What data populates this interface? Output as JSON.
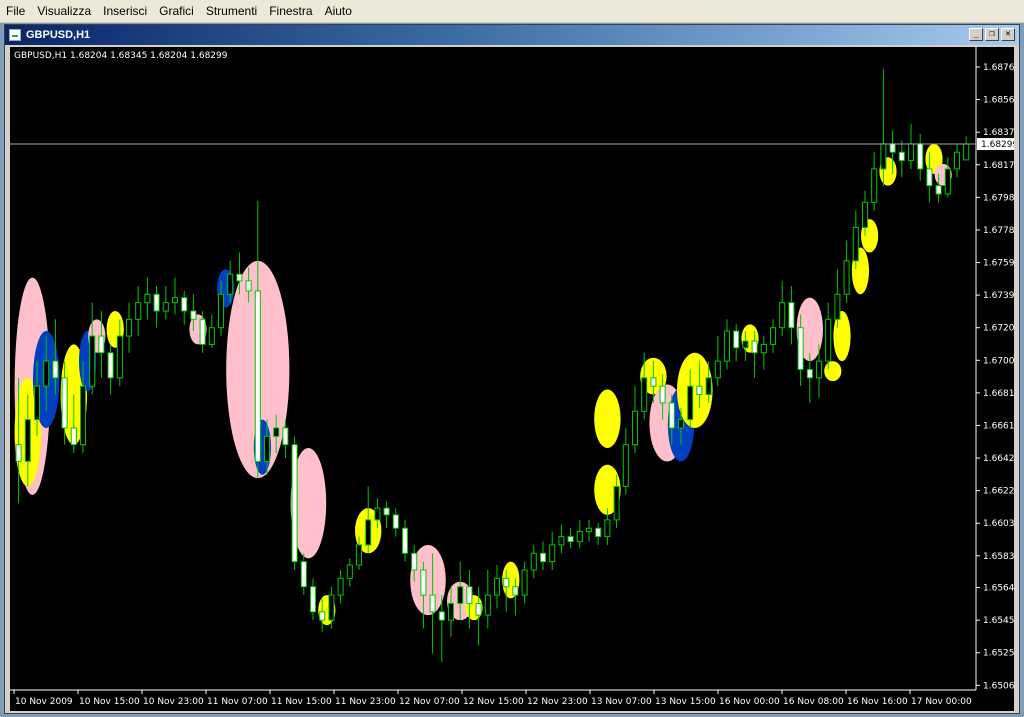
{
  "menubar": {
    "items": [
      "File",
      "Visualizza",
      "Inserisci",
      "Grafici",
      "Strumenti",
      "Finestra",
      "Aiuto"
    ]
  },
  "window": {
    "title": "GBPUSD,H1",
    "buttons": [
      "minimize",
      "restore",
      "close"
    ]
  },
  "chart": {
    "info": "GBPUSD,H1  1.68204 1.68345 1.68204 1.68299",
    "bid_label": "1.68299",
    "colors": {
      "background": "#000000",
      "candle_outline": "#00c800",
      "bull_body": "#000000",
      "bear_body": "#ffffff",
      "axis_text": "#ffffff",
      "bid_line": "#a0a8b0",
      "ellipse_pink": "#ffc0cb",
      "ellipse_yellow": "#ffff00",
      "ellipse_blue": "#0040c0"
    }
  },
  "chart_data": {
    "type": "candlestick",
    "symbol": "GBPUSD",
    "timeframe": "H1",
    "ylim": [
      1.6505,
      1.6876
    ],
    "y_ticks": [
      "1.68760",
      "1.68565",
      "1.68370",
      "1.68175",
      "1.67980",
      "1.67785",
      "1.67590",
      "1.67395",
      "1.67200",
      "1.67005",
      "1.66810",
      "1.66615",
      "1.66420",
      "1.66225",
      "1.66030",
      "1.65835",
      "1.65645",
      "1.65450",
      "1.65255",
      "1.65060"
    ],
    "x_ticks": [
      "10 Nov 2009",
      "10 Nov 15:00",
      "10 Nov 23:00",
      "11 Nov 07:00",
      "11 Nov 15:00",
      "11 Nov 23:00",
      "12 Nov 07:00",
      "12 Nov 15:00",
      "12 Nov 23:00",
      "13 Nov 07:00",
      "13 Nov 15:00",
      "16 Nov 00:00",
      "16 Nov 08:00",
      "16 Nov 16:00",
      "17 Nov 00:00"
    ],
    "bid": 1.68299,
    "candles": [
      {
        "o": 1.665,
        "c": 1.664,
        "h": 1.669,
        "l": 1.6615
      },
      {
        "o": 1.664,
        "c": 1.6665,
        "h": 1.668,
        "l": 1.6625
      },
      {
        "o": 1.6665,
        "c": 1.6685,
        "h": 1.67,
        "l": 1.6655
      },
      {
        "o": 1.6685,
        "c": 1.67,
        "h": 1.6715,
        "l": 1.667
      },
      {
        "o": 1.67,
        "c": 1.669,
        "h": 1.6725,
        "l": 1.668
      },
      {
        "o": 1.669,
        "c": 1.666,
        "h": 1.67,
        "l": 1.665
      },
      {
        "o": 1.666,
        "c": 1.665,
        "h": 1.668,
        "l": 1.6645
      },
      {
        "o": 1.665,
        "c": 1.6685,
        "h": 1.67,
        "l": 1.6645
      },
      {
        "o": 1.6685,
        "c": 1.6715,
        "h": 1.6735,
        "l": 1.668
      },
      {
        "o": 1.6715,
        "c": 1.6705,
        "h": 1.673,
        "l": 1.669
      },
      {
        "o": 1.6705,
        "c": 1.669,
        "h": 1.671,
        "l": 1.668
      },
      {
        "o": 1.669,
        "c": 1.6715,
        "h": 1.6725,
        "l": 1.6685
      },
      {
        "o": 1.6715,
        "c": 1.6725,
        "h": 1.6735,
        "l": 1.6705
      },
      {
        "o": 1.6725,
        "c": 1.6735,
        "h": 1.6745,
        "l": 1.6715
      },
      {
        "o": 1.6735,
        "c": 1.674,
        "h": 1.675,
        "l": 1.6725
      },
      {
        "o": 1.674,
        "c": 1.673,
        "h": 1.6745,
        "l": 1.672
      },
      {
        "o": 1.673,
        "c": 1.6735,
        "h": 1.6745,
        "l": 1.6725
      },
      {
        "o": 1.6735,
        "c": 1.6738,
        "h": 1.675,
        "l": 1.6728
      },
      {
        "o": 1.6738,
        "c": 1.673,
        "h": 1.6742,
        "l": 1.6722
      },
      {
        "o": 1.673,
        "c": 1.6725,
        "h": 1.674,
        "l": 1.6718
      },
      {
        "o": 1.6725,
        "c": 1.671,
        "h": 1.673,
        "l": 1.6705
      },
      {
        "o": 1.671,
        "c": 1.672,
        "h": 1.6728,
        "l": 1.6708
      },
      {
        "o": 1.672,
        "c": 1.674,
        "h": 1.6748,
        "l": 1.6715
      },
      {
        "o": 1.674,
        "c": 1.6752,
        "h": 1.676,
        "l": 1.6735
      },
      {
        "o": 1.6752,
        "c": 1.6748,
        "h": 1.6765,
        "l": 1.674
      },
      {
        "o": 1.6748,
        "c": 1.6742,
        "h": 1.6756,
        "l": 1.6735
      },
      {
        "o": 1.6742,
        "c": 1.664,
        "h": 1.6796,
        "l": 1.663
      },
      {
        "o": 1.664,
        "c": 1.6655,
        "h": 1.6665,
        "l": 1.6632
      },
      {
        "o": 1.6655,
        "c": 1.666,
        "h": 1.6668,
        "l": 1.6645
      },
      {
        "o": 1.666,
        "c": 1.665,
        "h": 1.6665,
        "l": 1.6642
      },
      {
        "o": 1.665,
        "c": 1.658,
        "h": 1.6655,
        "l": 1.6575
      },
      {
        "o": 1.658,
        "c": 1.6565,
        "h": 1.6585,
        "l": 1.656
      },
      {
        "o": 1.6565,
        "c": 1.655,
        "h": 1.657,
        "l": 1.6545
      },
      {
        "o": 1.655,
        "c": 1.6545,
        "h": 1.6558,
        "l": 1.6538
      },
      {
        "o": 1.6545,
        "c": 1.656,
        "h": 1.6565,
        "l": 1.654
      },
      {
        "o": 1.656,
        "c": 1.657,
        "h": 1.6575,
        "l": 1.6555
      },
      {
        "o": 1.657,
        "c": 1.6578,
        "h": 1.6582,
        "l": 1.6565
      },
      {
        "o": 1.6578,
        "c": 1.659,
        "h": 1.6595,
        "l": 1.6575
      },
      {
        "o": 1.659,
        "c": 1.6605,
        "h": 1.6625,
        "l": 1.6585
      },
      {
        "o": 1.6605,
        "c": 1.6612,
        "h": 1.6618,
        "l": 1.66
      },
      {
        "o": 1.6612,
        "c": 1.6608,
        "h": 1.6616,
        "l": 1.66
      },
      {
        "o": 1.6608,
        "c": 1.66,
        "h": 1.6612,
        "l": 1.6595
      },
      {
        "o": 1.66,
        "c": 1.6585,
        "h": 1.6605,
        "l": 1.658
      },
      {
        "o": 1.6585,
        "c": 1.6575,
        "h": 1.659,
        "l": 1.6568
      },
      {
        "o": 1.6575,
        "c": 1.656,
        "h": 1.658,
        "l": 1.654
      },
      {
        "o": 1.656,
        "c": 1.655,
        "h": 1.6585,
        "l": 1.6525
      },
      {
        "o": 1.655,
        "c": 1.6545,
        "h": 1.656,
        "l": 1.652
      },
      {
        "o": 1.6545,
        "c": 1.6555,
        "h": 1.6565,
        "l": 1.6535
      },
      {
        "o": 1.6555,
        "c": 1.6565,
        "h": 1.658,
        "l": 1.6545
      },
      {
        "o": 1.6565,
        "c": 1.6555,
        "h": 1.6575,
        "l": 1.654
      },
      {
        "o": 1.6555,
        "c": 1.6548,
        "h": 1.6565,
        "l": 1.653
      },
      {
        "o": 1.6548,
        "c": 1.656,
        "h": 1.6575,
        "l": 1.654
      },
      {
        "o": 1.656,
        "c": 1.657,
        "h": 1.6578,
        "l": 1.6552
      },
      {
        "o": 1.657,
        "c": 1.6565,
        "h": 1.6575,
        "l": 1.655
      },
      {
        "o": 1.6565,
        "c": 1.656,
        "h": 1.657,
        "l": 1.6548
      },
      {
        "o": 1.656,
        "c": 1.6575,
        "h": 1.658,
        "l": 1.6555
      },
      {
        "o": 1.6575,
        "c": 1.6585,
        "h": 1.659,
        "l": 1.657
      },
      {
        "o": 1.6585,
        "c": 1.658,
        "h": 1.6592,
        "l": 1.6575
      },
      {
        "o": 1.658,
        "c": 1.659,
        "h": 1.6598,
        "l": 1.6575
      },
      {
        "o": 1.659,
        "c": 1.6595,
        "h": 1.6602,
        "l": 1.6585
      },
      {
        "o": 1.6595,
        "c": 1.6592,
        "h": 1.66,
        "l": 1.6588
      },
      {
        "o": 1.6592,
        "c": 1.6598,
        "h": 1.6605,
        "l": 1.6588
      },
      {
        "o": 1.6598,
        "c": 1.66,
        "h": 1.6605,
        "l": 1.6592
      },
      {
        "o": 1.66,
        "c": 1.6595,
        "h": 1.6603,
        "l": 1.659
      },
      {
        "o": 1.6595,
        "c": 1.6605,
        "h": 1.6612,
        "l": 1.659
      },
      {
        "o": 1.6605,
        "c": 1.6625,
        "h": 1.6632,
        "l": 1.66
      },
      {
        "o": 1.6625,
        "c": 1.665,
        "h": 1.666,
        "l": 1.662
      },
      {
        "o": 1.665,
        "c": 1.667,
        "h": 1.6685,
        "l": 1.6645
      },
      {
        "o": 1.667,
        "c": 1.669,
        "h": 1.6705,
        "l": 1.6665
      },
      {
        "o": 1.669,
        "c": 1.6685,
        "h": 1.67,
        "l": 1.6675
      },
      {
        "o": 1.6685,
        "c": 1.6675,
        "h": 1.6692,
        "l": 1.6665
      },
      {
        "o": 1.6675,
        "c": 1.666,
        "h": 1.668,
        "l": 1.665
      },
      {
        "o": 1.666,
        "c": 1.6665,
        "h": 1.6672,
        "l": 1.665
      },
      {
        "o": 1.6665,
        "c": 1.6685,
        "h": 1.6695,
        "l": 1.666
      },
      {
        "o": 1.6685,
        "c": 1.668,
        "h": 1.67,
        "l": 1.6672
      },
      {
        "o": 1.668,
        "c": 1.669,
        "h": 1.67,
        "l": 1.6675
      },
      {
        "o": 1.669,
        "c": 1.67,
        "h": 1.6715,
        "l": 1.6685
      },
      {
        "o": 1.67,
        "c": 1.6718,
        "h": 1.6725,
        "l": 1.6695
      },
      {
        "o": 1.6718,
        "c": 1.6708,
        "h": 1.6722,
        "l": 1.67
      },
      {
        "o": 1.6708,
        "c": 1.6712,
        "h": 1.6718,
        "l": 1.67
      },
      {
        "o": 1.6712,
        "c": 1.6705,
        "h": 1.6718,
        "l": 1.669
      },
      {
        "o": 1.6705,
        "c": 1.671,
        "h": 1.6715,
        "l": 1.6695
      },
      {
        "o": 1.671,
        "c": 1.672,
        "h": 1.6725,
        "l": 1.6705
      },
      {
        "o": 1.672,
        "c": 1.6735,
        "h": 1.6748,
        "l": 1.6715
      },
      {
        "o": 1.6735,
        "c": 1.672,
        "h": 1.6745,
        "l": 1.671
      },
      {
        "o": 1.672,
        "c": 1.6695,
        "h": 1.6728,
        "l": 1.6685
      },
      {
        "o": 1.6695,
        "c": 1.669,
        "h": 1.6705,
        "l": 1.6675
      },
      {
        "o": 1.669,
        "c": 1.67,
        "h": 1.671,
        "l": 1.6678
      },
      {
        "o": 1.67,
        "c": 1.6725,
        "h": 1.6735,
        "l": 1.6695
      },
      {
        "o": 1.6725,
        "c": 1.674,
        "h": 1.6755,
        "l": 1.672
      },
      {
        "o": 1.674,
        "c": 1.676,
        "h": 1.6772,
        "l": 1.6735
      },
      {
        "o": 1.676,
        "c": 1.678,
        "h": 1.679,
        "l": 1.6755
      },
      {
        "o": 1.678,
        "c": 1.6795,
        "h": 1.6802,
        "l": 1.6775
      },
      {
        "o": 1.6795,
        "c": 1.6815,
        "h": 1.6825,
        "l": 1.679
      },
      {
        "o": 1.6815,
        "c": 1.683,
        "h": 1.6875,
        "l": 1.6805
      },
      {
        "o": 1.683,
        "c": 1.6825,
        "h": 1.6838,
        "l": 1.6812
      },
      {
        "o": 1.6825,
        "c": 1.682,
        "h": 1.6832,
        "l": 1.681
      },
      {
        "o": 1.682,
        "c": 1.683,
        "h": 1.6842,
        "l": 1.6815
      },
      {
        "o": 1.683,
        "c": 1.6815,
        "h": 1.6836,
        "l": 1.6808
      },
      {
        "o": 1.6815,
        "c": 1.6805,
        "h": 1.6825,
        "l": 1.6795
      },
      {
        "o": 1.6805,
        "c": 1.68,
        "h": 1.6812,
        "l": 1.6795
      },
      {
        "o": 1.68,
        "c": 1.6815,
        "h": 1.6822,
        "l": 1.6798
      },
      {
        "o": 1.6815,
        "c": 1.6825,
        "h": 1.683,
        "l": 1.681
      },
      {
        "o": 1.68204,
        "c": 1.68299,
        "h": 1.68345,
        "l": 1.68204
      }
    ],
    "ellipses": [
      {
        "i0": 0,
        "i1": 3,
        "hi": 1.675,
        "lo": 1.662,
        "color": "pink"
      },
      {
        "i0": 0,
        "i1": 2,
        "hi": 1.669,
        "lo": 1.6625,
        "color": "yellow"
      },
      {
        "i0": 2,
        "i1": 4,
        "hi": 1.6718,
        "lo": 1.666,
        "color": "blue"
      },
      {
        "i0": 5,
        "i1": 7,
        "hi": 1.671,
        "lo": 1.665,
        "color": "yellow"
      },
      {
        "i0": 7,
        "i1": 8,
        "hi": 1.6718,
        "lo": 1.6682,
        "color": "blue"
      },
      {
        "i0": 8,
        "i1": 9,
        "hi": 1.6725,
        "lo": 1.6705,
        "color": "pink"
      },
      {
        "i0": 10,
        "i1": 11,
        "hi": 1.673,
        "lo": 1.6708,
        "color": "yellow"
      },
      {
        "i0": 19,
        "i1": 20,
        "hi": 1.6728,
        "lo": 1.671,
        "color": "pink"
      },
      {
        "i0": 22,
        "i1": 23,
        "hi": 1.6755,
        "lo": 1.6732,
        "color": "blue"
      },
      {
        "i0": 23,
        "i1": 29,
        "hi": 1.676,
        "lo": 1.663,
        "color": "pink"
      },
      {
        "i0": 26,
        "i1": 27,
        "hi": 1.6665,
        "lo": 1.6632,
        "color": "blue"
      },
      {
        "i0": 30,
        "i1": 33,
        "hi": 1.6648,
        "lo": 1.6582,
        "color": "pink"
      },
      {
        "i0": 33,
        "i1": 34,
        "hi": 1.656,
        "lo": 1.6542,
        "color": "yellow"
      },
      {
        "i0": 37,
        "i1": 39,
        "hi": 1.6612,
        "lo": 1.6585,
        "color": "yellow"
      },
      {
        "i0": 43,
        "i1": 46,
        "hi": 1.659,
        "lo": 1.6548,
        "color": "pink"
      },
      {
        "i0": 47,
        "i1": 49,
        "hi": 1.6568,
        "lo": 1.6545,
        "color": "pink"
      },
      {
        "i0": 49,
        "i1": 50,
        "hi": 1.656,
        "lo": 1.6545,
        "color": "yellow"
      },
      {
        "i0": 53,
        "i1": 54,
        "hi": 1.658,
        "lo": 1.6558,
        "color": "yellow"
      },
      {
        "i0": 63,
        "i1": 65,
        "hi": 1.6638,
        "lo": 1.6608,
        "color": "yellow"
      },
      {
        "i0": 63,
        "i1": 65,
        "hi": 1.6683,
        "lo": 1.6648,
        "color": "yellow"
      },
      {
        "i0": 68,
        "i1": 70,
        "hi": 1.6702,
        "lo": 1.668,
        "color": "yellow"
      },
      {
        "i0": 69,
        "i1": 72,
        "hi": 1.6686,
        "lo": 1.664,
        "color": "pink"
      },
      {
        "i0": 71,
        "i1": 73,
        "hi": 1.6684,
        "lo": 1.664,
        "color": "blue"
      },
      {
        "i0": 72,
        "i1": 75,
        "hi": 1.6705,
        "lo": 1.666,
        "color": "yellow"
      },
      {
        "i0": 79,
        "i1": 80,
        "hi": 1.6722,
        "lo": 1.6705,
        "color": "yellow"
      },
      {
        "i0": 85,
        "i1": 87,
        "hi": 1.6738,
        "lo": 1.67,
        "color": "pink"
      },
      {
        "i0": 88,
        "i1": 89,
        "hi": 1.67,
        "lo": 1.6688,
        "color": "yellow"
      },
      {
        "i0": 89,
        "i1": 90,
        "hi": 1.673,
        "lo": 1.67,
        "color": "yellow"
      },
      {
        "i0": 91,
        "i1": 92,
        "hi": 1.6768,
        "lo": 1.674,
        "color": "yellow"
      },
      {
        "i0": 92,
        "i1": 93,
        "hi": 1.6785,
        "lo": 1.6765,
        "color": "yellow"
      },
      {
        "i0": 94,
        "i1": 95,
        "hi": 1.6822,
        "lo": 1.6805,
        "color": "yellow"
      },
      {
        "i0": 99,
        "i1": 100,
        "hi": 1.683,
        "lo": 1.6812,
        "color": "yellow"
      },
      {
        "i0": 100,
        "i1": 101,
        "hi": 1.6818,
        "lo": 1.6805,
        "color": "pink"
      }
    ]
  }
}
